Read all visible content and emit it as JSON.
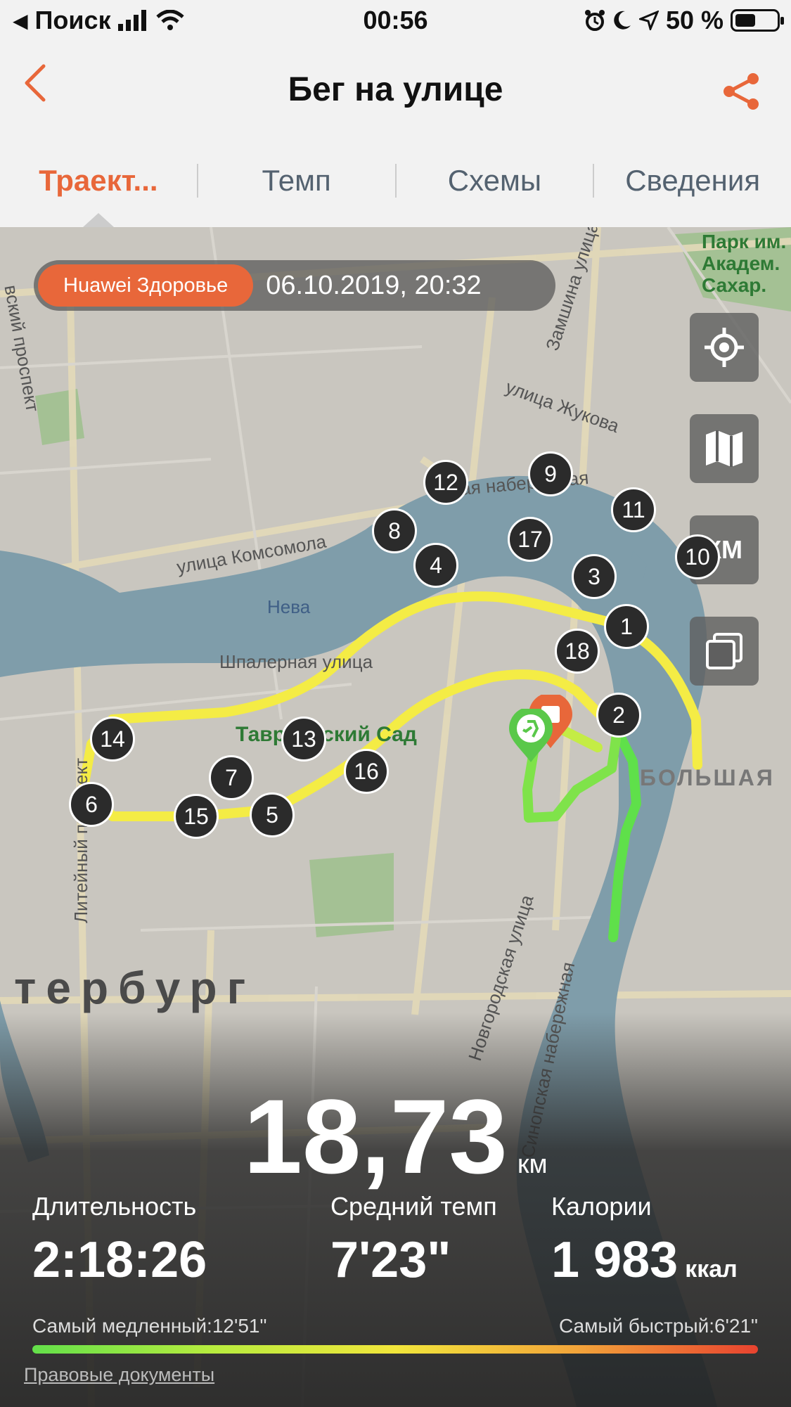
{
  "status_bar": {
    "back_app": "Поиск",
    "time": "00:56",
    "battery": "50 %",
    "icons": [
      "cellular-signal-icon",
      "wifi-icon",
      "alarm-icon",
      "moon-icon",
      "location-arrow-icon",
      "battery-icon"
    ]
  },
  "nav": {
    "title": "Бег на улице",
    "back_icon": "chevron-left-icon",
    "share_icon": "share-icon",
    "accent": "#e8673a"
  },
  "tabs": [
    {
      "label": "Траект...",
      "active": true
    },
    {
      "label": "Темп",
      "active": false
    },
    {
      "label": "Схемы",
      "active": false
    },
    {
      "label": "Сведения",
      "active": false
    }
  ],
  "map": {
    "source_tag": "Huawei Здоровье",
    "date": "06.10.2019, 20:32",
    "buttons": {
      "locate_icon": "crosshair-icon",
      "map_icon": "map-icon",
      "units_label": "КМ",
      "layers_icon": "layers-icon"
    },
    "labels": {
      "street_zamshina": "Замшина улица",
      "street_zhukova": "улица Жукова",
      "street_komsomola": "улица Комсомола",
      "river_neva": "Нева",
      "street_shpalernaya": "Шпалерная улица",
      "garden": "Таврический Сад",
      "liteyny": "Литейный проспект",
      "park": "Парк им. Академ. Сахар.",
      "prospekt": "вский проспект",
      "nab_fragment": "ская набережная",
      "bolshaya": "БОЛЬШАЯ",
      "city": "тербург",
      "novgorodskaya": "Новгородская улица",
      "sinopskaya": "Синопская набережная"
    },
    "km_markers": [
      "1",
      "2",
      "3",
      "4",
      "5",
      "6",
      "7",
      "8",
      "9",
      "10",
      "11",
      "12",
      "13",
      "14",
      "15",
      "16",
      "17",
      "18"
    ]
  },
  "summary": {
    "distance": "18,73",
    "distance_unit": "км",
    "duration_label": "Длительность",
    "duration": "2:18:26",
    "pace_label": "Средний темп",
    "pace": "7'23\"",
    "calories_label": "Калории",
    "calories": "1 983",
    "calories_unit": "ккал",
    "slowest": "Самый медленный:12'51\"",
    "fastest": "Самый быстрый:6'21\"",
    "legal_link": "Правовые документы"
  }
}
